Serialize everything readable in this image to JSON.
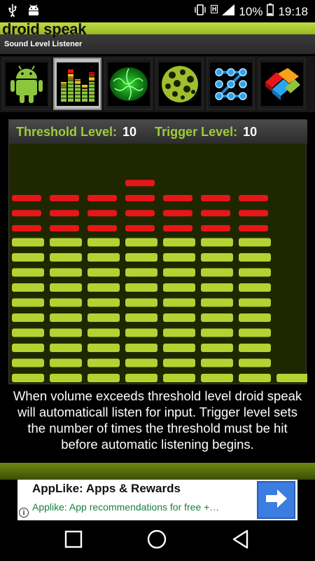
{
  "status_bar": {
    "battery_percent": "10%",
    "time": "19:18",
    "network_badge": "H"
  },
  "app": {
    "title": "droid speak",
    "subtitle": "Sound Level Listener"
  },
  "tabs": [
    {
      "icon": "android-icon",
      "selected": false
    },
    {
      "icon": "equalizer-icon",
      "selected": true
    },
    {
      "icon": "green-brain-icon",
      "selected": false
    },
    {
      "icon": "green-sphere-icon",
      "selected": false
    },
    {
      "icon": "connect-dots-icon",
      "selected": false
    },
    {
      "icon": "colored-blocks-icon",
      "selected": false
    }
  ],
  "levels": {
    "threshold_label": "Threshold Level:",
    "threshold_value": "10",
    "trigger_label": "Trigger Level:",
    "trigger_value": "10"
  },
  "meter": {
    "columns": 8,
    "max_segments": 13,
    "green_levels": [
      10,
      10,
      10,
      10,
      10,
      10,
      10,
      1
    ],
    "red_levels": [
      3,
      3,
      3,
      4,
      3,
      3,
      3,
      0
    ],
    "colors": {
      "green": "#b5d233",
      "red": "#e8161b",
      "background": "#1f2700"
    }
  },
  "description": "When volume exceeds threshold level droid speak will automaticall listen for input.  Trigger level sets the number of times the threshold must be hit before automatic listening begins.",
  "ad": {
    "title": "AppLike: Apps & Rewards",
    "subtitle": "Applike: App recommendations for free +…",
    "info_label": "i"
  },
  "navigation": {
    "recents": "square-icon",
    "home": "circle-icon",
    "back": "triangle-back-icon"
  }
}
